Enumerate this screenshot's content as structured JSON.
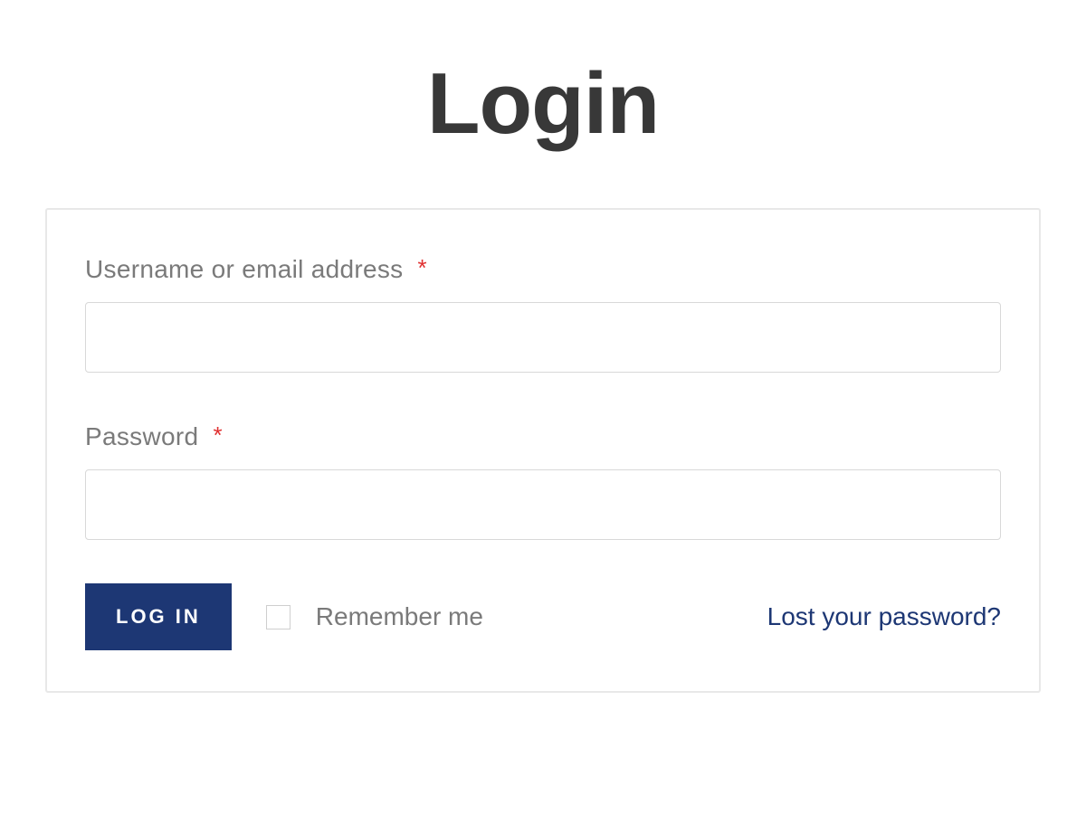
{
  "title": "Login",
  "username": {
    "label": "Username or email address",
    "required_mark": "*",
    "value": ""
  },
  "password": {
    "label": "Password",
    "required_mark": "*",
    "value": ""
  },
  "actions": {
    "submit_label": "LOG IN",
    "remember_label": "Remember me",
    "lost_password_label": "Lost your password?"
  },
  "colors": {
    "primary": "#1d3774",
    "title": "#383838",
    "label": "#7a7a7a",
    "required": "#e03030",
    "border": "#e8e8e8"
  }
}
